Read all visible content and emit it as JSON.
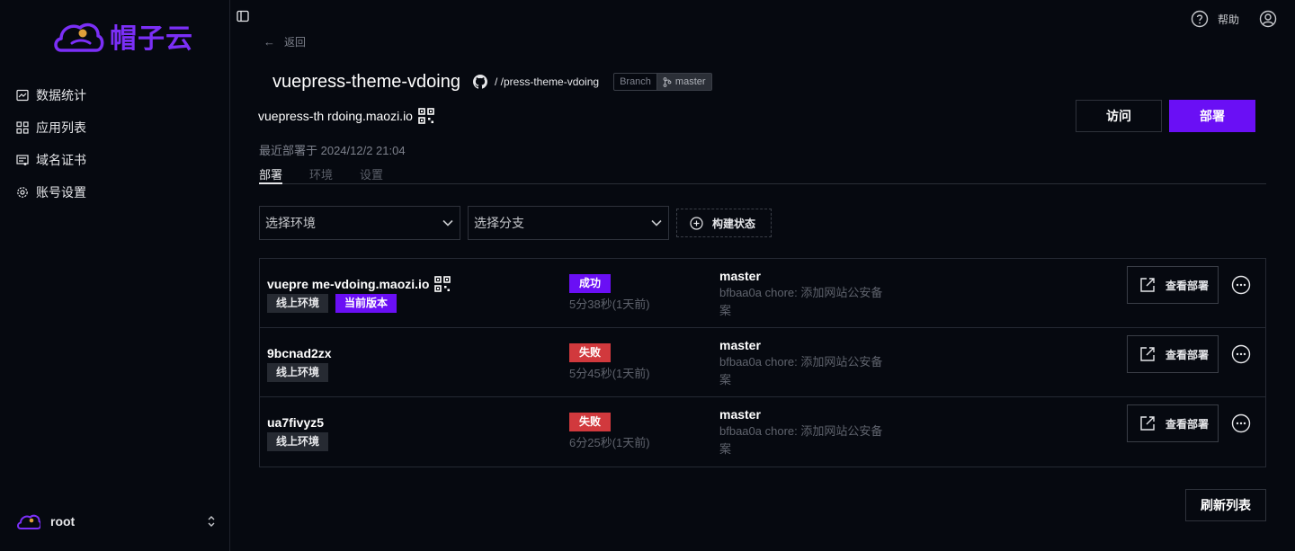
{
  "brand": {
    "name": "帽子云",
    "color": "#7b2ff7"
  },
  "sidebar": {
    "items": [
      {
        "label": "数据统计",
        "icon": "chart-icon"
      },
      {
        "label": "应用列表",
        "icon": "grid-icon"
      },
      {
        "label": "域名证书",
        "icon": "certificate-icon"
      },
      {
        "label": "账号设置",
        "icon": "gear-icon"
      }
    ],
    "user": {
      "name": "root"
    }
  },
  "header": {
    "help_label": "帮助"
  },
  "back_label": "返回",
  "project": {
    "title": "vuepress-theme-vdoing",
    "repo": "/ /press-theme-vdoing",
    "branch_key": "Branch",
    "branch_value": "master",
    "domain": "vuepress-th  rdoing.maozi.io",
    "last_deployed": "最近部署于 2024/12/2 21:04"
  },
  "actions": {
    "visit_label": "访问",
    "deploy_label": "部署",
    "accent": "#6a0ff5"
  },
  "tabs": [
    "部署",
    "环境",
    "设置"
  ],
  "filters": {
    "env_placeholder": "选择环境",
    "branch_placeholder": "选择分支",
    "status_label": "构建状态"
  },
  "deployments": [
    {
      "name": "vuepre    me-vdoing.maozi.io",
      "env": "线上环境",
      "current": "当前版本",
      "status": "成功",
      "duration": "5分38秒(1天前)",
      "branch": "master",
      "commit_line1": "bfbaa0a chore: 添加网站公安备",
      "commit_line2": "案",
      "view_label": "查看部署"
    },
    {
      "name": "9bcnad2zx",
      "env": "线上环境",
      "status": "失败",
      "duration": "5分45秒(1天前)",
      "branch": "master",
      "commit_line1": "bfbaa0a chore: 添加网站公安备",
      "commit_line2": "案",
      "view_label": "查看部署"
    },
    {
      "name": "ua7fivyz5",
      "env": "线上环境",
      "status": "失败",
      "duration": "6分25秒(1天前)",
      "branch": "master",
      "commit_line1": "bfbaa0a chore: 添加网站公安备",
      "commit_line2": "案",
      "view_label": "查看部署"
    }
  ],
  "refresh_label": "刷新列表",
  "colors": {
    "success": "#6a0ff5",
    "failure": "#d1393d",
    "background": "#060910"
  }
}
